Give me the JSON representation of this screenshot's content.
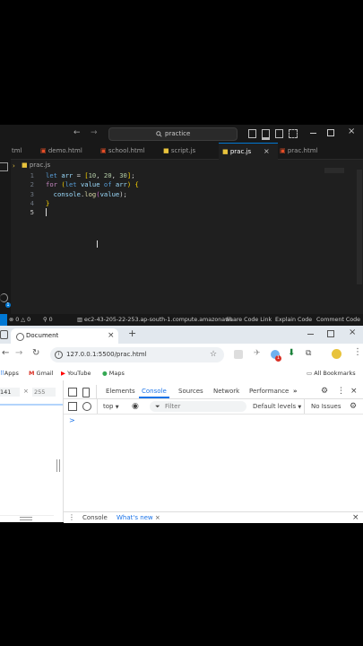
{
  "vscode": {
    "search_text": "practice",
    "tabs": [
      {
        "label": "tml"
      },
      {
        "label": "demo.html"
      },
      {
        "label": "school.html"
      },
      {
        "label": "script.js"
      },
      {
        "label": "prac.js"
      },
      {
        "label": "prac.html"
      }
    ],
    "breadcrumb": "prac.js",
    "line_numbers": [
      "1",
      "2",
      "3",
      "4",
      "5"
    ],
    "code": {
      "l1": {
        "kw": "let",
        "var": "arr",
        "eq": " = ",
        "ob": "[",
        "n1": "10",
        "n2": "20",
        "n3": "30",
        "cb": "]",
        "semi": ";"
      },
      "l2": {
        "ctl": "for",
        "op": "(",
        "kw": "let",
        "var1": "value",
        "of": "of",
        "var2": "arr",
        "cp": ")",
        "brace": "{"
      },
      "l3": {
        "obj": "console",
        "fn": "log",
        "op": "(",
        "arg": "value",
        "tail": ");"
      },
      "l4": {
        "brace": "}"
      }
    },
    "status": {
      "errors": "0",
      "warnings": "0",
      "ports": "0",
      "remote": "ec2-43-205-22-253.ap-south-1.compute.amazonaws",
      "share": "Share Code Link",
      "explain": "Explain Code",
      "comment": "Comment Code"
    }
  },
  "chrome": {
    "tab_title": "Document",
    "url": "127.0.0.1:5500/prac.html",
    "bookmarks": [
      "Apps",
      "Gmail",
      "YouTube",
      "Maps"
    ],
    "all_bookmarks": "All Bookmarks",
    "notification_count": "1",
    "devtools": {
      "dims": {
        "width": "141",
        "height": "255"
      },
      "tabs": [
        "Elements",
        "Console",
        "Sources",
        "Network",
        "Performance"
      ],
      "context": "top",
      "filter_placeholder": "Filter",
      "levels": "Default levels",
      "issues": "No Issues",
      "prompt": ">",
      "drawer_tabs": [
        "Console",
        "What's new"
      ]
    }
  },
  "colors": {
    "accent": "#0078d4",
    "statusbar": "#181818",
    "console_tab": "#1a73e8"
  }
}
